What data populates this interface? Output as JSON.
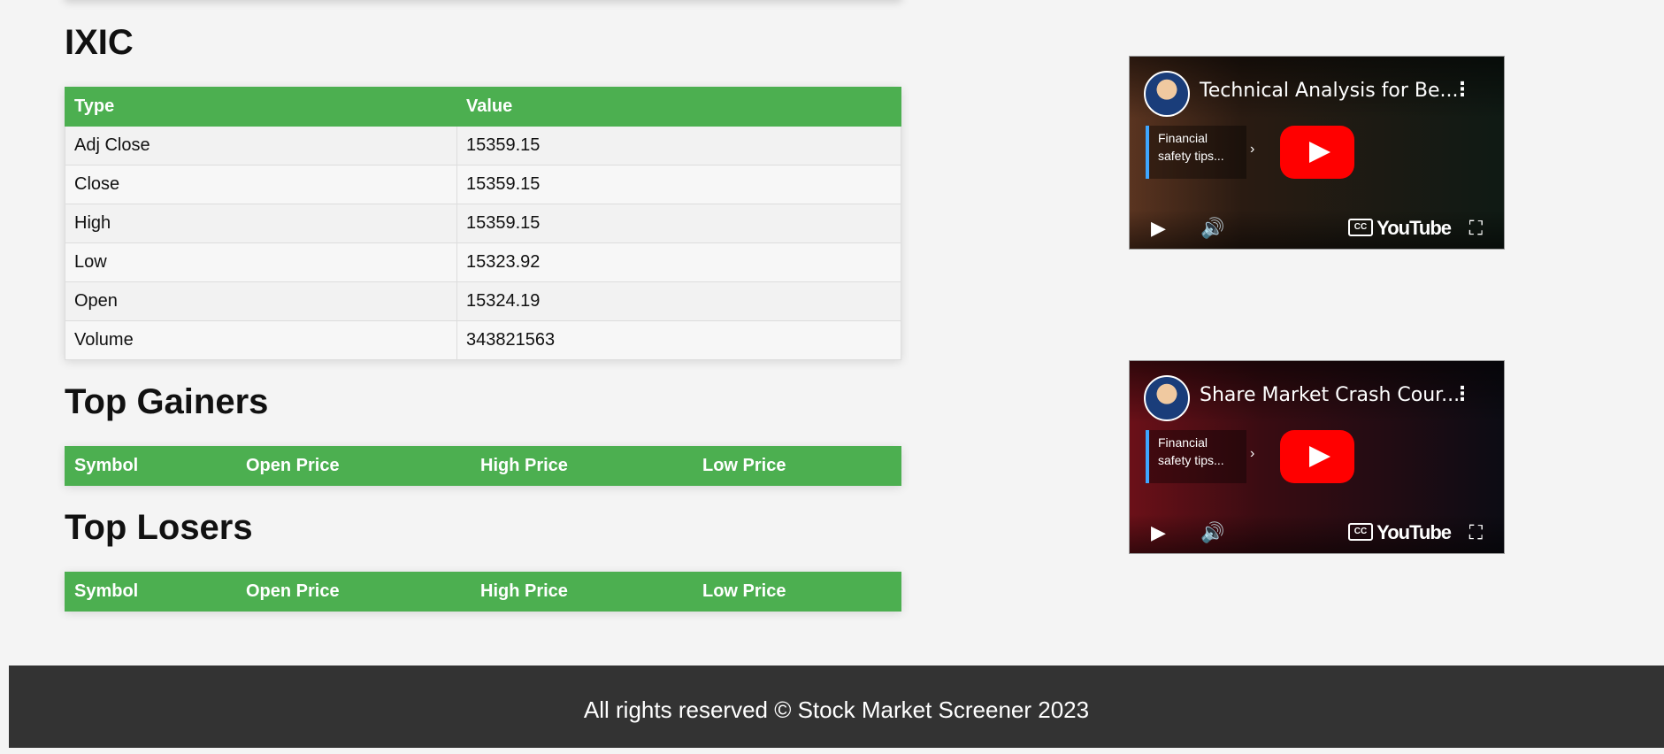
{
  "index_section": {
    "title": "IXIC",
    "headers": [
      "Type",
      "Value"
    ],
    "rows": [
      [
        "Adj Close",
        "15359.15"
      ],
      [
        "Close",
        "15359.15"
      ],
      [
        "High",
        "15359.15"
      ],
      [
        "Low",
        "15323.92"
      ],
      [
        "Open",
        "15324.19"
      ],
      [
        "Volume",
        "343821563"
      ]
    ]
  },
  "gainers": {
    "title": "Top Gainers",
    "headers": [
      "Symbol",
      "Open Price",
      "High Price",
      "Low Price"
    ]
  },
  "losers": {
    "title": "Top Losers",
    "headers": [
      "Symbol",
      "Open Price",
      "High Price",
      "Low Price"
    ]
  },
  "videos": [
    {
      "title": "Technical Analysis for Be...",
      "card": "Financial safety tips...",
      "brand": "YouTube",
      "colors": {
        "bg1": "#2a1b12",
        "bg2": "#0f1a14",
        "text": "#d9a81a"
      }
    },
    {
      "title": "Share Market Crash Cour...",
      "card": "Financial safety tips...",
      "brand": "YouTube",
      "colors": {
        "bg1": "#5a0f14",
        "bg2": "#0c0c14",
        "text": "#e07f2a"
      }
    }
  ],
  "footer": {
    "text": "All rights reserved © Stock Market Screener 2023"
  },
  "theme": {
    "accent": "#4caf50",
    "footer_bg": "#333333",
    "page_bg": "#f4f4f4"
  }
}
